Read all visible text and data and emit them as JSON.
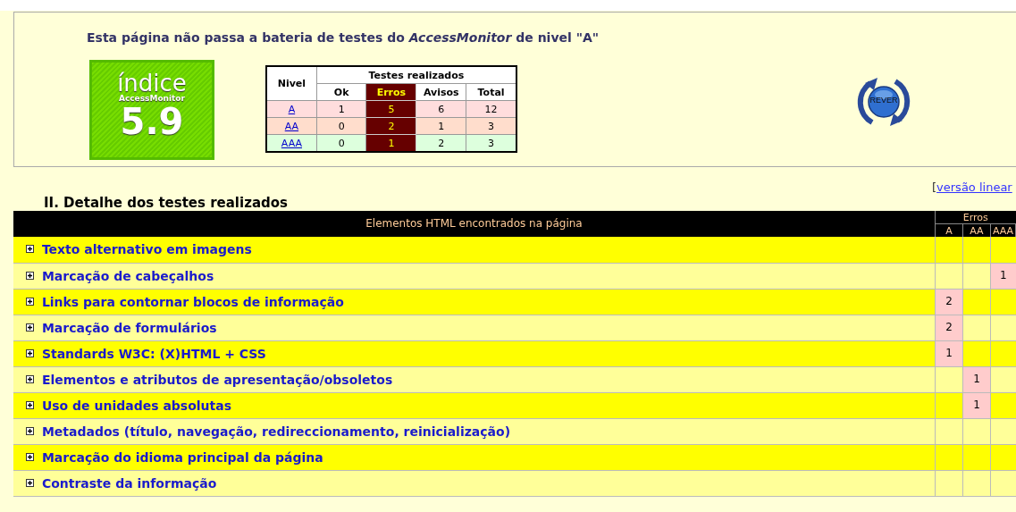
{
  "summary": {
    "message": "Esta página não passa a bateria de testes do *AccessMonitor* de nivel \"A\"",
    "index": {
      "title": "índice",
      "brand": "AccessMonitor",
      "score": "5.9"
    },
    "levels_table": {
      "level_header": "Nivel",
      "group_header": "Testes realizados",
      "columns": [
        "Ok",
        "Erros",
        "Avisos",
        "Total"
      ],
      "rows": [
        {
          "level": "A",
          "color": "#ffdddd",
          "ok": "1",
          "erros": "5",
          "avisos": "6",
          "total": "12"
        },
        {
          "level": "AA",
          "color": "#ffddcc",
          "ok": "0",
          "erros": "2",
          "avisos": "1",
          "total": "3"
        },
        {
          "level": "AAA",
          "color": "#ddffdd",
          "ok": "0",
          "erros": "1",
          "avisos": "2",
          "total": "3"
        }
      ]
    },
    "rever_button": {
      "label": "REVER"
    }
  },
  "linear_link": {
    "open": "[",
    "label": "versão linear"
  },
  "section_title": "II. Detalhe dos testes realizados",
  "details_table": {
    "header": "Elementos HTML encontrados na página",
    "errors_header": "Erros",
    "levels": [
      "A",
      "AA",
      "AAA"
    ],
    "rows": [
      {
        "label": "Texto alternativo em imagens"
      },
      {
        "label": "Marcação de cabeçalhos",
        "errors_aaa": "1"
      },
      {
        "label": "Links para contornar blocos de informação",
        "errors_a": "2"
      },
      {
        "label": "Marcação de formulários",
        "errors_a": "2"
      },
      {
        "label": "Standards W3C: (X)HTML + CSS",
        "errors_a": "1"
      },
      {
        "label": "Elementos e atributos de apresentação/obsoletos",
        "errors_aa": "1"
      },
      {
        "label": "Uso de unidades absolutas",
        "errors_aa": "1"
      },
      {
        "label": "Metadados (título, navegação, redireccionamento, reinicialização)"
      },
      {
        "label": "Marcação do idioma principal da página"
      },
      {
        "label": "Contraste da informação"
      }
    ]
  }
}
